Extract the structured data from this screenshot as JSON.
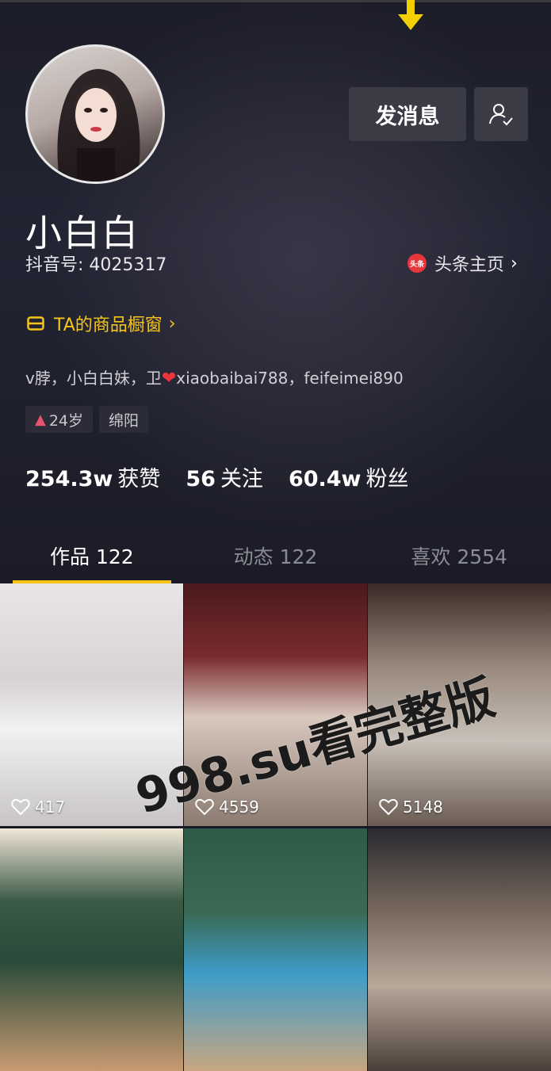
{
  "profile": {
    "name": "小白白",
    "douyin_id": "抖音号: 4025317",
    "toutiao_logo_text": "头条",
    "toutiao_label": "头条主页",
    "shop_label": "TA的商品橱窗",
    "bio_before_heart": "v脖，小白白妹，卫",
    "bio_after_heart": "xiaobaibai788，feifeimei890",
    "tags": {
      "age": "24岁",
      "city": "绵阳"
    }
  },
  "actions": {
    "message_button": "发消息",
    "follow_icon": "user-check-icon"
  },
  "stats": [
    {
      "value": "254.3w",
      "label": "获赞"
    },
    {
      "value": "56",
      "label": "关注"
    },
    {
      "value": "60.4w",
      "label": "粉丝"
    }
  ],
  "tabs": [
    {
      "label": "作品 122",
      "active": true
    },
    {
      "label": "动态 122",
      "active": false
    },
    {
      "label": "喜欢 2554",
      "active": false
    }
  ],
  "videos": [
    {
      "likes": "417"
    },
    {
      "likes": "4559"
    },
    {
      "likes": "5148"
    },
    {
      "likes": ""
    },
    {
      "likes": ""
    },
    {
      "likes": ""
    }
  ],
  "watermark": "998.su看完整版",
  "colors": {
    "accent": "#f5c518",
    "background": "#161823",
    "heart": "#e8363b"
  }
}
